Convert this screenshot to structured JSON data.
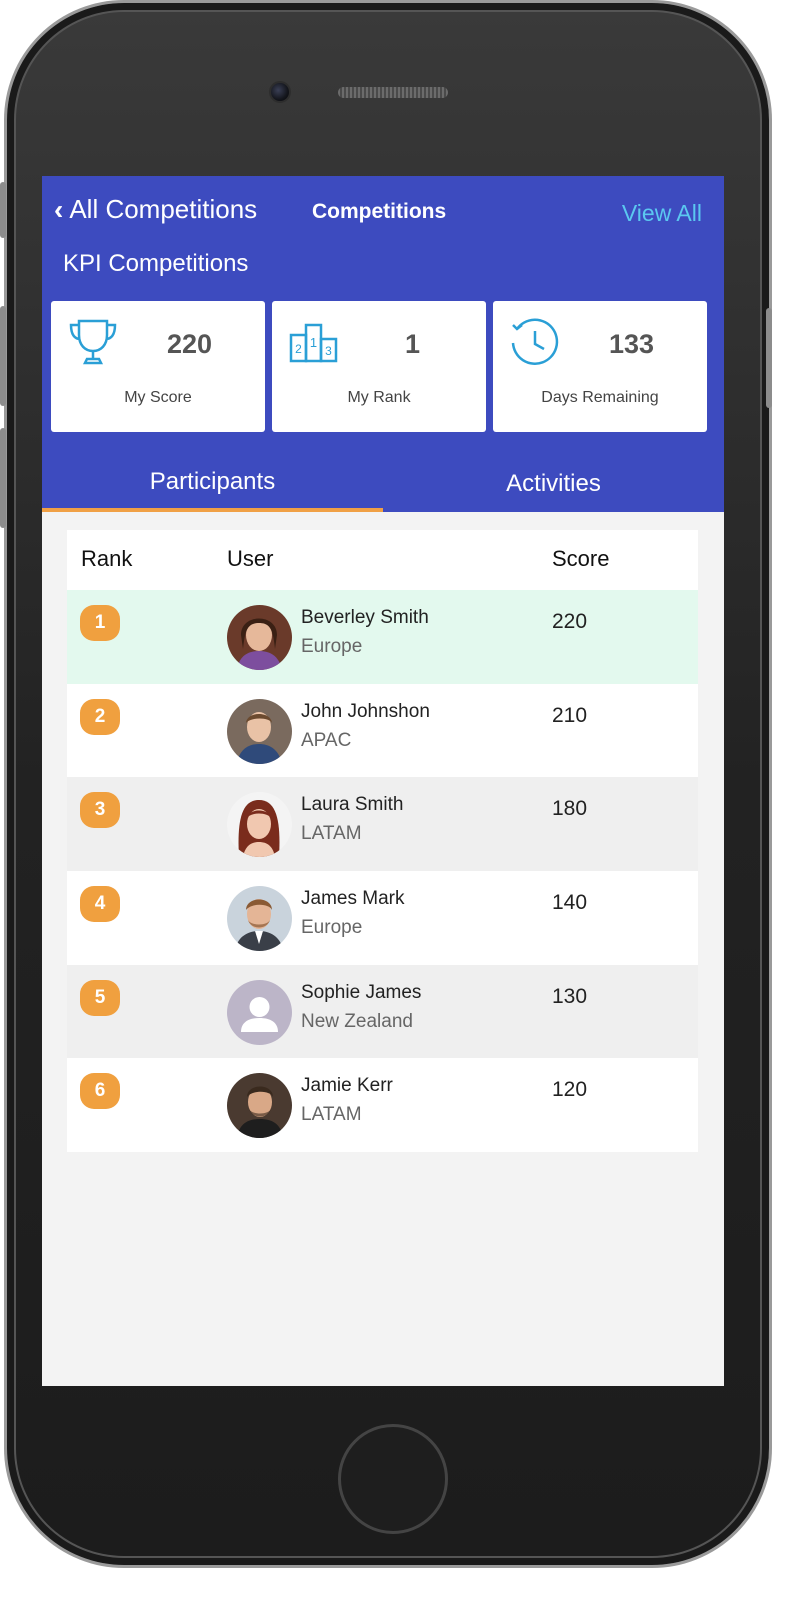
{
  "header": {
    "back_label": "All Competitions",
    "title": "Competitions",
    "view_all": "View All",
    "subtitle": "KPI Competitions"
  },
  "stats": [
    {
      "value": "220",
      "label": "My Score",
      "icon": "trophy-icon"
    },
    {
      "value": "1",
      "label": "My Rank",
      "icon": "podium-icon"
    },
    {
      "value": "133",
      "label": "Days Remaining",
      "icon": "clock-icon"
    }
  ],
  "tabs": [
    {
      "label": "Participants",
      "active": true
    },
    {
      "label": "Activities",
      "active": false
    }
  ],
  "table": {
    "headers": {
      "rank": "Rank",
      "user": "User",
      "score": "Score"
    },
    "rows": [
      {
        "rank": "1",
        "name": "Beverley Smith",
        "region": "Europe",
        "score": "220",
        "bg": "#e3f9ee"
      },
      {
        "rank": "2",
        "name": "John Johnshon",
        "region": "APAC",
        "score": "210",
        "bg": "#ffffff"
      },
      {
        "rank": "3",
        "name": "Laura Smith",
        "region": "LATAM",
        "score": "180",
        "bg": "#efefef"
      },
      {
        "rank": "4",
        "name": "James Mark",
        "region": "Europe",
        "score": "140",
        "bg": "#ffffff"
      },
      {
        "rank": "5",
        "name": "Sophie James",
        "region": "New Zealand",
        "score": "130",
        "bg": "#efefef"
      },
      {
        "rank": "6",
        "name": "Jamie Kerr",
        "region": "LATAM",
        "score": "120",
        "bg": "#ffffff"
      }
    ]
  },
  "colors": {
    "header_bg": "#3d4bbf",
    "accent": "#f0a03f",
    "link": "#5bc8f0",
    "icon": "#2a9fd6"
  }
}
